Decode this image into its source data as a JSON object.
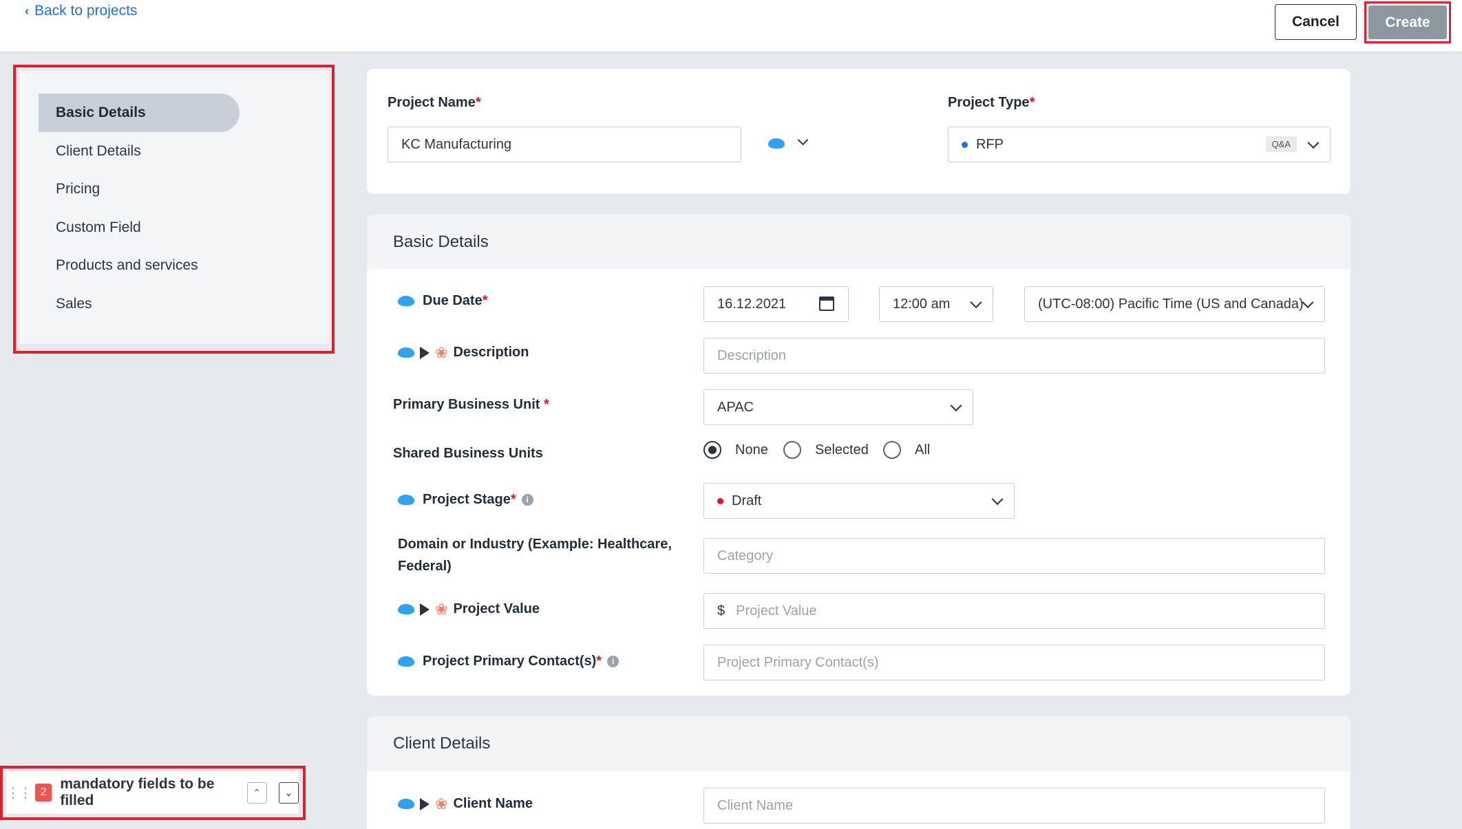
{
  "header": {
    "back_label": "Back to projects",
    "cancel_label": "Cancel",
    "create_label": "Create"
  },
  "sidebar": {
    "items": [
      {
        "label": "Basic Details"
      },
      {
        "label": "Client Details"
      },
      {
        "label": "Pricing"
      },
      {
        "label": "Custom Field"
      },
      {
        "label": "Products and services"
      },
      {
        "label": "Sales"
      }
    ]
  },
  "mandatory": {
    "count": "2",
    "text": "mandatory fields to be filled"
  },
  "top_card": {
    "project_name_label": "Project Name",
    "project_name_value": "KC Manufacturing",
    "project_type_label": "Project Type",
    "project_type_value": "RFP",
    "project_type_badge": "Q&A"
  },
  "basic_details": {
    "title": "Basic Details",
    "due_date_label": "Due Date",
    "due_date_value": "16.12.2021",
    "time_value": "12:00 am",
    "timezone_value": "(UTC-08:00) Pacific Time (US and Canada)",
    "description_label": "Description",
    "description_placeholder": "Description",
    "primary_bu_label": "Primary Business Unit",
    "primary_bu_value": "APAC",
    "shared_bu_label": "Shared Business Units",
    "shared_options": [
      "None",
      "Selected",
      "All"
    ],
    "stage_label": "Project Stage",
    "stage_value": "Draft",
    "domain_label_1": "Domain or Industry (Example: Healthcare,",
    "domain_label_2": "Federal)",
    "domain_placeholder": "Category",
    "value_label": "Project Value",
    "value_prefix": "$",
    "value_placeholder": "Project Value",
    "contact_label": "Project Primary Contact(s)",
    "contact_placeholder": "Project Primary Contact(s)"
  },
  "client_details": {
    "title": "Client Details",
    "client_name_label": "Client Name",
    "client_name_placeholder": "Client Name"
  },
  "colors": {
    "highlight_red": "#e21f2b",
    "link_blue": "#1a73e8",
    "draft_dot": "#e0142a",
    "rfp_dot": "#1a73e8",
    "salesforce_blue": "#2ea3f2",
    "hubspot_orange": "#ff7a59"
  }
}
